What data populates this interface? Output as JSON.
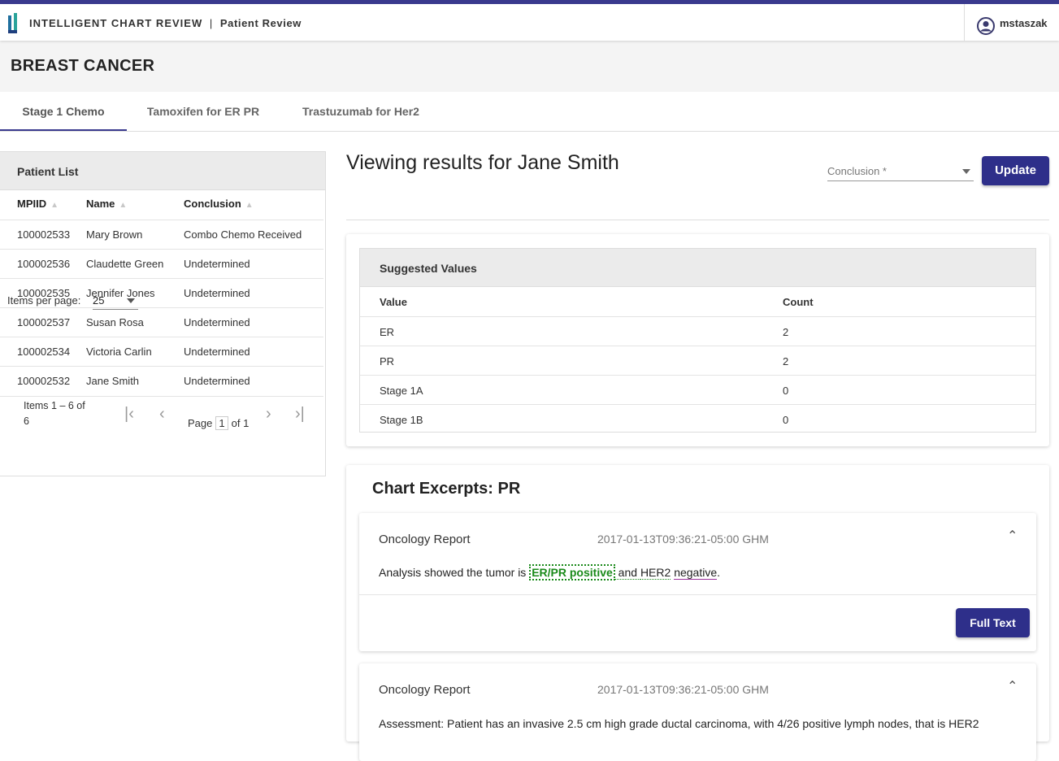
{
  "app": {
    "title": "INTELLIGENT CHART REVIEW",
    "separator": "|",
    "subtitle": "Patient Review",
    "user": "mstaszak"
  },
  "page": {
    "title": "BREAST CANCER"
  },
  "tabs": [
    "Stage 1 Chemo",
    "Tamoxifen for ER PR",
    "Trastuzumab for Her2"
  ],
  "patient_list": {
    "title": "Patient List",
    "columns": [
      "MPIID",
      "Name",
      "Conclusion"
    ],
    "rows": [
      [
        "100002533",
        "Mary Brown",
        "Combo Chemo Received"
      ],
      [
        "100002536",
        "Claudette Green",
        "Undetermined"
      ],
      [
        "100002535",
        "Jennifer Jones",
        "Undetermined"
      ],
      [
        "100002537",
        "Susan Rosa",
        "Undetermined"
      ],
      [
        "100002534",
        "Victoria Carlin",
        "Undetermined"
      ],
      [
        "100002532",
        "Jane Smith",
        "Undetermined"
      ]
    ],
    "pager": {
      "items_label": "Items 1 – 6 of 6",
      "page_label": "Page",
      "page_value": "1",
      "of_label": "of 1",
      "per_page_label": "Items per page:",
      "per_page_value": "25"
    }
  },
  "main": {
    "viewing_title": "Viewing results for Jane Smith",
    "conclusion_placeholder": "Conclusion *",
    "update_label": "Update",
    "suggested": {
      "title": "Suggested Values",
      "columns": [
        "Value",
        "Count"
      ],
      "rows": [
        [
          "ER",
          "2"
        ],
        [
          "PR",
          "2"
        ],
        [
          "Stage 1A",
          "0"
        ],
        [
          "Stage 1B",
          "0"
        ]
      ]
    },
    "excerpts": {
      "title": "Chart Excerpts: PR",
      "items": [
        {
          "type": "Oncology Report",
          "date": "2017-01-13T09:36:21-05:00 GHM",
          "text_before": "Analysis showed the tumor is ",
          "highlight": "ER/PR positive",
          "text_mid": " and ",
          "her2": "HER2",
          "space": " ",
          "negative": "negative",
          "text_end": ".",
          "full_text_label": "Full Text"
        },
        {
          "type": "Oncology Report",
          "date": "2017-01-13T09:36:21-05:00 GHM",
          "text": "Assessment: Patient has an invasive 2.5 cm high grade ductal carcinoma, with 4/26 positive lymph nodes, that is HER2"
        }
      ]
    }
  },
  "icons": {
    "logo": "app-logo-icon",
    "user": "user-avatar-icon",
    "collapse": "chevron-up-icon"
  },
  "colors": {
    "accent": "#2e2f8a",
    "highlight": "#1a8a1a",
    "negative_underline": "#9b2f9b"
  }
}
